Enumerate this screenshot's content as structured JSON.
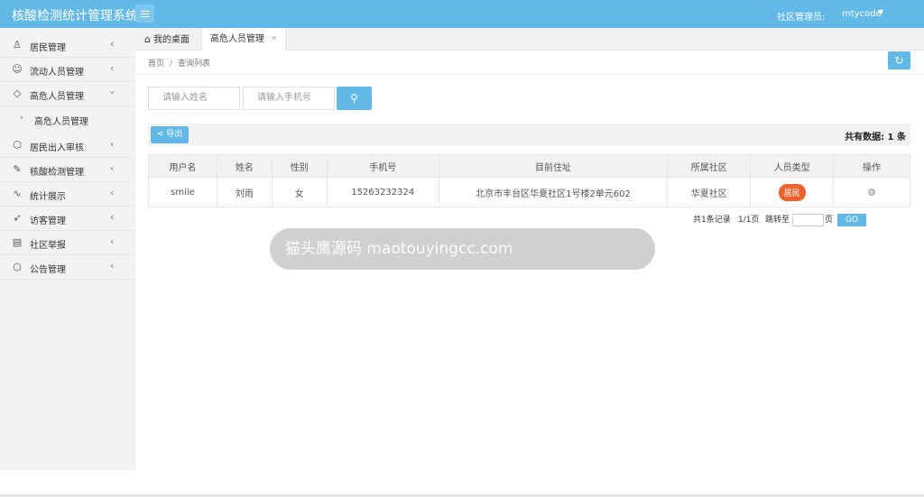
{
  "header": {
    "app_title": "核酸检测统计管理系统",
    "role_label": "社区管理员:",
    "user_name": "mtycode",
    "user_caret": "▼"
  },
  "sidebar": {
    "items": [
      {
        "label": "居民管理",
        "icon": "person-icon"
      },
      {
        "label": "流动人员管理",
        "icon": "users-icon"
      },
      {
        "label": "高危人员管理",
        "icon": "shield-icon"
      },
      {
        "label": "居民出入审核",
        "icon": "cube-icon"
      },
      {
        "label": "核酸检测管理",
        "icon": "edit-icon"
      },
      {
        "label": "统计展示",
        "icon": "pulse-icon"
      },
      {
        "label": "访客管理",
        "icon": "send-icon"
      },
      {
        "label": "社区举报",
        "icon": "clipboard-icon"
      },
      {
        "label": "公告管理",
        "icon": "circle-icon"
      }
    ],
    "sub_item": {
      "label": "高危人员管理"
    }
  },
  "tabs": {
    "home": "我的桌面",
    "active": "高危人员管理",
    "close": "×"
  },
  "breadcrumb": {
    "home": "首页",
    "sep": "/",
    "current": "查询列表"
  },
  "search": {
    "name_placeholder": "请输入姓名",
    "phone_placeholder": "请输入手机号"
  },
  "toolbar": {
    "export_label": "导出",
    "total_label": "共有数据: 1 条"
  },
  "table": {
    "headers": [
      "用户名",
      "姓名",
      "性别",
      "手机号",
      "目前住址",
      "所属社区",
      "人员类型",
      "操作"
    ],
    "rows": [
      {
        "username": "smile",
        "name": "刘雨",
        "gender": "女",
        "phone": "15263232324",
        "address": "北京市丰台区华夏社区1号楼2单元602",
        "community": "华夏社区",
        "type": "居民",
        "action_icon": "settings-icon"
      }
    ]
  },
  "pager": {
    "summary": "共1条记录",
    "page_info": "1/1页",
    "jump_label": "跳转至",
    "page_suffix": "页",
    "go_label": "GO"
  },
  "watermark": {
    "text": "猫头鹰源码 maotouyingcc.com"
  },
  "colors": {
    "accent": "#62b9e7",
    "badge": "#f0622d"
  }
}
